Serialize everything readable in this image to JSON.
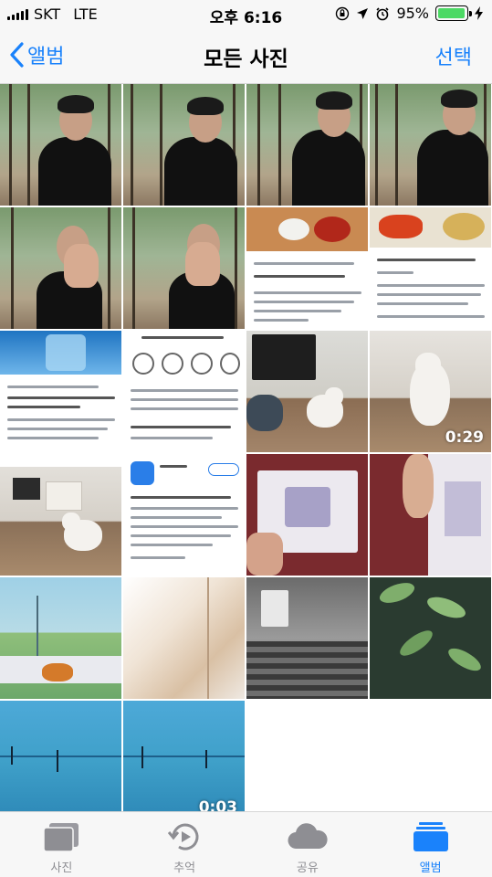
{
  "status": {
    "carrier": "SKT",
    "network": "LTE",
    "time": "오후 6:16",
    "battery": "95%",
    "battery_level": 0.95
  },
  "nav": {
    "back_label": "앨범",
    "title": "모든 사진",
    "select_label": "선택"
  },
  "grid": {
    "video_durations": [
      "0:29",
      "0:03"
    ]
  },
  "tabs": [
    {
      "label": "사진",
      "icon": "photos-icon"
    },
    {
      "label": "추억",
      "icon": "memories-icon"
    },
    {
      "label": "공유",
      "icon": "cloud-icon"
    },
    {
      "label": "앨범",
      "icon": "albums-icon"
    }
  ],
  "colors": {
    "accent": "#1a82fb",
    "battery": "#4cd964",
    "inactive": "#8e8e93"
  }
}
